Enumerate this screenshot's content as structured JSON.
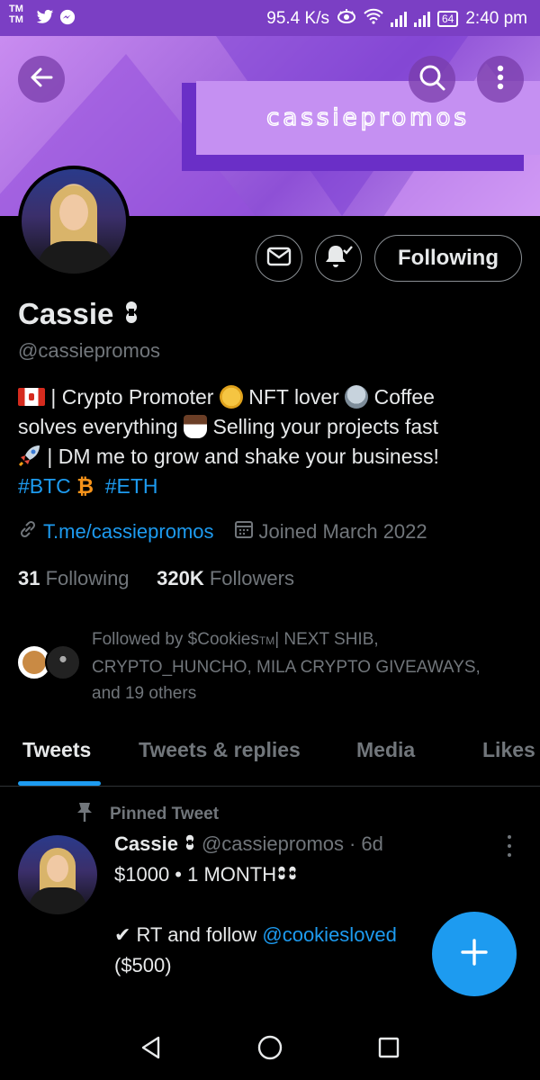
{
  "status_bar": {
    "left_marks": [
      "TM",
      "TM"
    ],
    "left_icons": [
      "twitter-icon",
      "messenger-icon"
    ],
    "speed": "95.4 K/s",
    "battery": "64",
    "time": "2:40 pm"
  },
  "banner": {
    "text": "cassiepromos"
  },
  "profile": {
    "name": "Cassie",
    "handle": "@cassiepromos",
    "following_button": "Following",
    "bio": {
      "line1": " | Crypto Promoter ",
      "line1b": " NFT lover ",
      "line1c": " Coffee",
      "line2": "solves everything ",
      "line2b": " Selling your projects fast",
      "line3": " | DM me to grow and shake your business!",
      "tag1": "#BTC",
      "tag2": "#ETH"
    },
    "link": "T.me/cassiepromos",
    "joined": "Joined March 2022",
    "following_count": "31",
    "following_label": "Following",
    "followers_count": "320K",
    "followers_label": "Followers",
    "followed_by": {
      "prefix": "Followed by $Cookies",
      "tm": "TM",
      "rest": "| NEXT SHIB,",
      "line2": "CRYPTO_HUNCHO, MILA CRYPTO GIVEAWAYS,",
      "line3": "and 19 others"
    }
  },
  "tabs": [
    {
      "label": "Tweets",
      "active": true
    },
    {
      "label": "Tweets & replies",
      "active": false
    },
    {
      "label": "Media",
      "active": false
    },
    {
      "label": "Likes",
      "active": false
    }
  ],
  "pinned_tweet": {
    "label": "Pinned Tweet",
    "name": "Cassie",
    "handle": "@cassiepromos",
    "separator": "·",
    "age": "6d",
    "line1": "$1000 • 1 MONTH",
    "line2_prefix": "✔ RT and follow ",
    "line2_mention": "@cookiesloved",
    "line3": "($500)"
  },
  "colors": {
    "accent": "#1d9bf0",
    "status_bar": "#7b3fc4",
    "background": "#000000"
  }
}
